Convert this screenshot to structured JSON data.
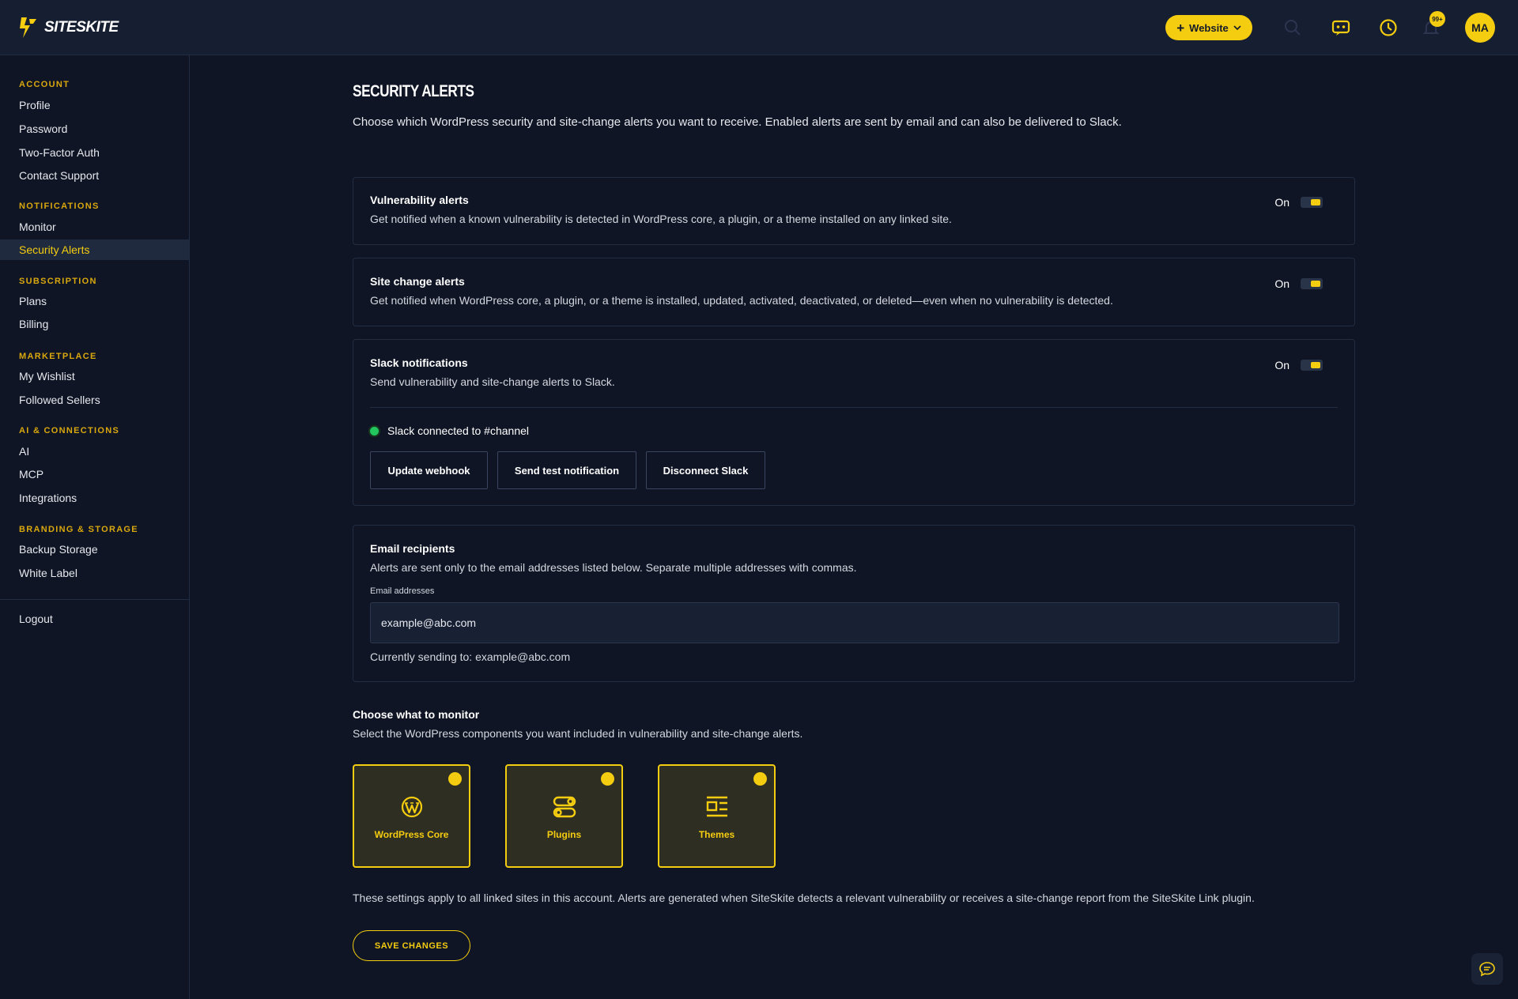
{
  "app": {
    "brand": "SITESKITE",
    "add_site_label": "Website",
    "notification_count": "99+",
    "avatar_initials": "MA"
  },
  "sidebar": {
    "sections": [
      {
        "heading": "ACCOUNT",
        "items": [
          "Profile",
          "Password",
          "Two-Factor Auth",
          "Contact Support"
        ]
      },
      {
        "heading": "NOTIFICATIONS",
        "items": [
          "Monitor",
          "Security Alerts"
        ]
      },
      {
        "heading": "SUBSCRIPTION",
        "items": [
          "Plans",
          "Billing"
        ]
      },
      {
        "heading": "MARKETPLACE",
        "items": [
          "My Wishlist",
          "Followed Sellers"
        ]
      },
      {
        "heading": "AI & CONNECTIONS",
        "items": [
          "AI",
          "MCP",
          "Integrations"
        ]
      },
      {
        "heading": "BRANDING & STORAGE",
        "items": [
          "Backup Storage",
          "White Label"
        ]
      }
    ],
    "active_item": "Security Alerts",
    "logout": "Logout"
  },
  "page": {
    "title": "SECURITY ALERTS",
    "description": "Choose which WordPress security and site-change alerts you want to receive. Enabled alerts are sent by email and can also be delivered to Slack."
  },
  "alerts": [
    {
      "title": "Vulnerability alerts",
      "description": "Get notified when a known vulnerability is detected in WordPress core, a plugin, or a theme installed on any linked site.",
      "state": "On"
    },
    {
      "title": "Site change alerts",
      "description": "Get notified when WordPress core, a plugin, or a theme is installed, updated, activated, deactivated, or deleted—even when no vulnerability is detected.",
      "state": "On"
    }
  ],
  "slack": {
    "title": "Slack notifications",
    "description": "Send vulnerability and site-change alerts to Slack.",
    "state": "On",
    "status": "Slack connected to #channel",
    "buttons": {
      "update": "Update webhook",
      "test": "Send test notification",
      "disconnect": "Disconnect Slack"
    }
  },
  "email": {
    "title": "Email recipients",
    "description": "Alerts are sent only to the email addresses listed below. Separate multiple addresses with commas.",
    "field_label": "Email addresses",
    "value": "example@abc.com",
    "currently_sending": "Currently sending to: example@abc.com"
  },
  "monitor": {
    "title": "Choose what to monitor",
    "description": "Select the WordPress components you want included in vulnerability and site-change alerts.",
    "options": [
      {
        "label": "WordPress Core",
        "icon": "wordpress-icon",
        "selected": true
      },
      {
        "label": "Plugins",
        "icon": "plugins-icon",
        "selected": true
      },
      {
        "label": "Themes",
        "icon": "themes-icon",
        "selected": true
      }
    ]
  },
  "footnote": "These settings apply to all linked sites in this account. Alerts are generated when SiteSkite detects a relevant vulnerability or receives a site-change report from the SiteSkite Link plugin.",
  "save_label": "SAVE CHANGES",
  "colors": {
    "accent": "#f5cd10",
    "background": "#0f1524",
    "topbar": "#161e31",
    "success": "#22c55e"
  }
}
